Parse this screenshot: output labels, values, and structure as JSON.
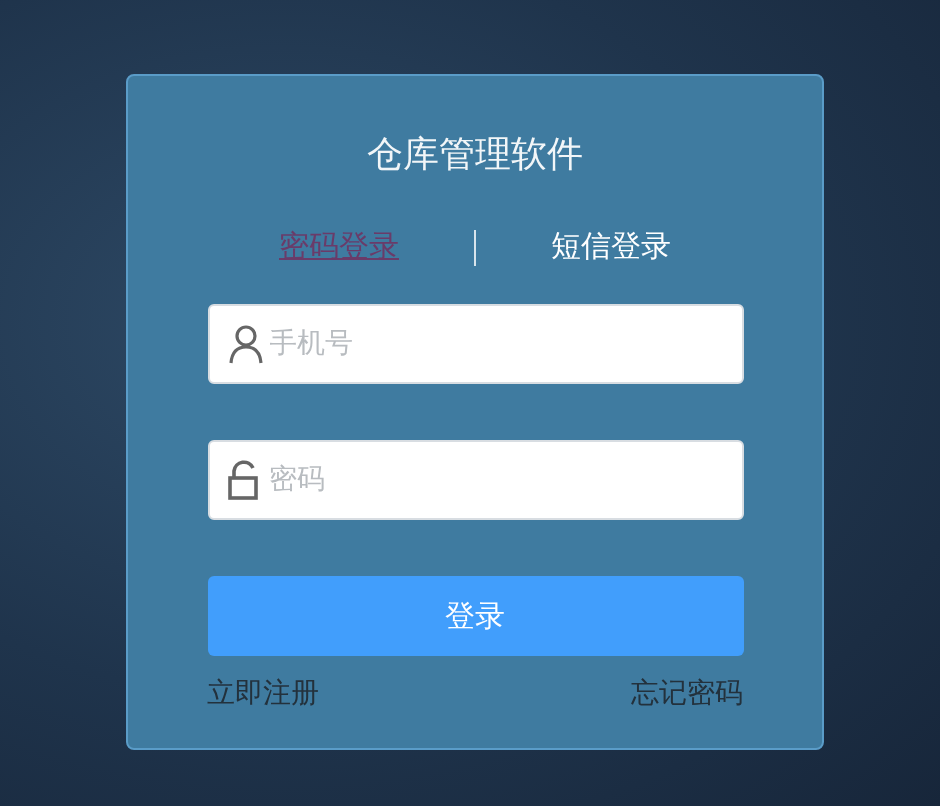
{
  "title": "仓库管理软件",
  "tabs": [
    {
      "label": "密码登录",
      "selected": true
    },
    {
      "label": "短信登录",
      "selected": false
    }
  ],
  "fields": [
    {
      "kind": "phone",
      "placeholder": "手机号"
    },
    {
      "kind": "password",
      "placeholder": "密码"
    }
  ],
  "login_button": "登录",
  "links": [
    "立即注册",
    "忘记密码"
  ]
}
